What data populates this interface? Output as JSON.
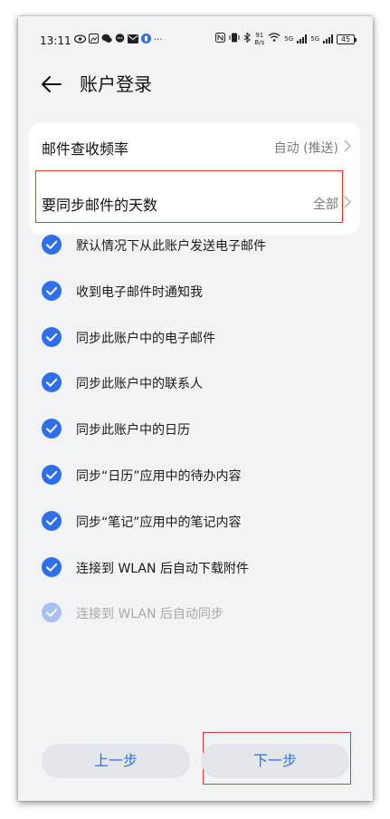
{
  "status_bar": {
    "time": "13:11",
    "left_icons": [
      "eye-icon",
      "image-icon",
      "wechat-icon",
      "chat-icon",
      "mail-icon",
      "app-icon",
      "more-icon"
    ],
    "more": "···",
    "speed_value": "91",
    "speed_unit": "B/s",
    "network_1": "5G",
    "network_2": "5G",
    "battery": "45"
  },
  "header": {
    "title": "账户登录"
  },
  "settings": [
    {
      "label": "邮件查收频率",
      "value": "自动 (推送)"
    },
    {
      "label": "要同步邮件的天数",
      "value": "全部"
    }
  ],
  "options": [
    {
      "label": "默认情况下从此账户发送电子邮件",
      "checked": true,
      "enabled": true
    },
    {
      "label": "收到电子邮件时通知我",
      "checked": true,
      "enabled": true
    },
    {
      "label": "同步此账户中的电子邮件",
      "checked": true,
      "enabled": true
    },
    {
      "label": "同步此账户中的联系人",
      "checked": true,
      "enabled": true
    },
    {
      "label": "同步此账户中的日历",
      "checked": true,
      "enabled": true
    },
    {
      "label": "同步“日历”应用中的待办内容",
      "checked": true,
      "enabled": true
    },
    {
      "label": "同步“笔记”应用中的笔记内容",
      "checked": true,
      "enabled": true
    },
    {
      "label": "连接到 WLAN 后自动下载附件",
      "checked": true,
      "enabled": true
    },
    {
      "label": "连接到 WLAN 后自动同步",
      "checked": true,
      "enabled": false
    }
  ],
  "buttons": {
    "prev": "上一步",
    "next": "下一步"
  },
  "colors": {
    "accent": "#2f6fea",
    "disabled_accent": "#a8c0f2",
    "highlight_box": "#e53935",
    "background": "#f1f3f5"
  }
}
